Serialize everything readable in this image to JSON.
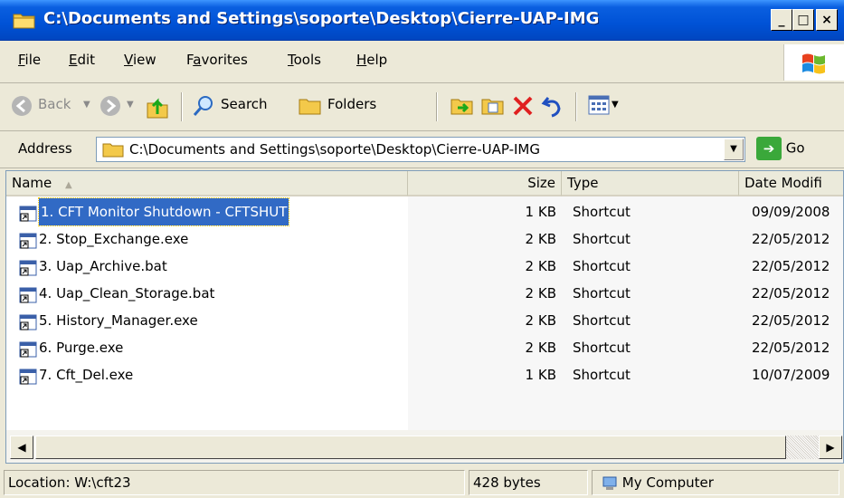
{
  "window": {
    "title": "C:\\Documents and Settings\\soporte\\Desktop\\Cierre-UAP-IMG"
  },
  "menu": [
    {
      "label": "File",
      "ul": "F",
      "rest": "ile"
    },
    {
      "label": "Edit",
      "ul": "E",
      "rest": "dit"
    },
    {
      "label": "View",
      "ul": "V",
      "rest": "iew"
    },
    {
      "label": "Favorites",
      "pre": "F",
      "ul": "a",
      "rest": "vorites"
    },
    {
      "label": "Tools",
      "ul": "T",
      "rest": "ools"
    },
    {
      "label": "Help",
      "ul": "H",
      "rest": "elp"
    }
  ],
  "toolbar": {
    "back_label": "Back",
    "search_label": "Search",
    "folders_label": "Folders"
  },
  "address": {
    "label": "Address",
    "value": "C:\\Documents and Settings\\soporte\\Desktop\\Cierre-UAP-IMG",
    "go_label": "Go"
  },
  "columns": {
    "name": "Name",
    "size": "Size",
    "type": "Type",
    "date": "Date Modifi"
  },
  "files": [
    {
      "name": "1. CFT Monitor Shutdown - CFTSHUT",
      "size": "1 KB",
      "type": "Shortcut",
      "date": "09/09/2008",
      "selected": true
    },
    {
      "name": "2. Stop_Exchange.exe",
      "size": "2 KB",
      "type": "Shortcut",
      "date": "22/05/2012"
    },
    {
      "name": "3. Uap_Archive.bat",
      "size": "2 KB",
      "type": "Shortcut",
      "date": "22/05/2012"
    },
    {
      "name": "4. Uap_Clean_Storage.bat",
      "size": "2 KB",
      "type": "Shortcut",
      "date": "22/05/2012"
    },
    {
      "name": "5. History_Manager.exe",
      "size": "2 KB",
      "type": "Shortcut",
      "date": "22/05/2012"
    },
    {
      "name": "6. Purge.exe",
      "size": "2 KB",
      "type": "Shortcut",
      "date": "22/05/2012"
    },
    {
      "name": "7. Cft_Del.exe",
      "size": "1 KB",
      "type": "Shortcut",
      "date": "10/07/2009"
    }
  ],
  "status": {
    "location": "Location: W:\\cft23",
    "size": "428 bytes",
    "zone": "My Computer"
  },
  "colors": {
    "titlebar": "#0052d6",
    "selection": "#316ac5"
  }
}
